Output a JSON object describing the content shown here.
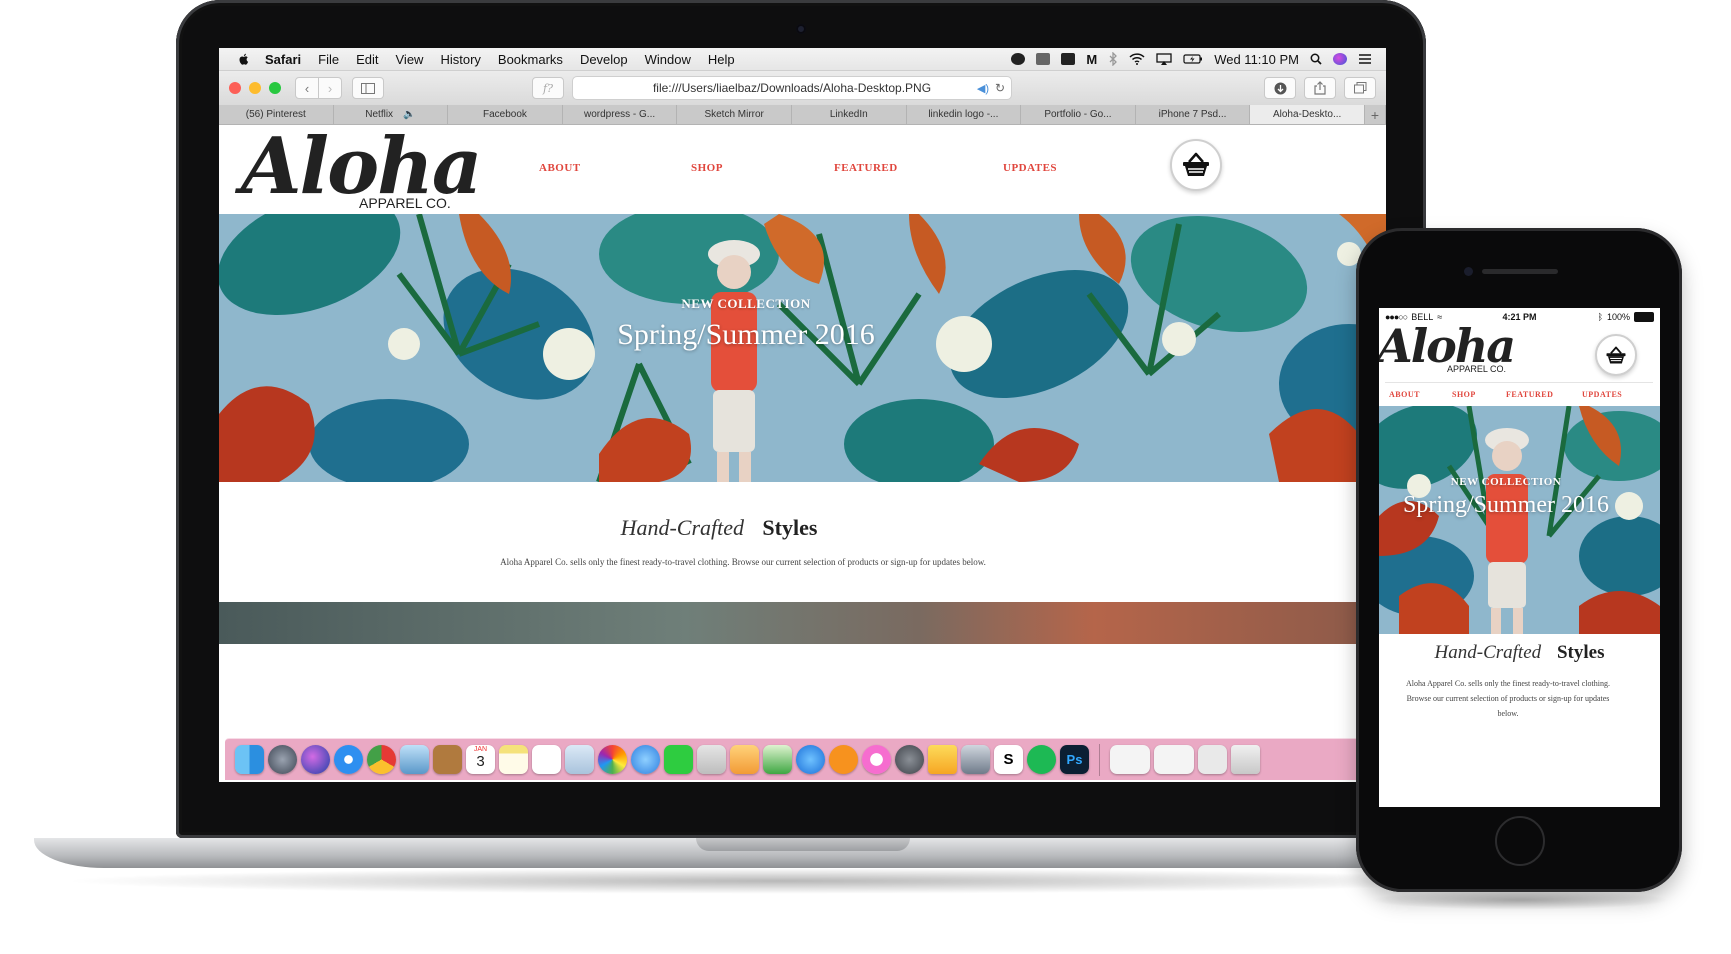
{
  "menubar": {
    "app": "Safari",
    "items": [
      "File",
      "Edit",
      "View",
      "History",
      "Bookmarks",
      "Develop",
      "Window",
      "Help"
    ],
    "clock": "Wed 11:10 PM"
  },
  "toolbar": {
    "address": "file:///Users/liaelbaz/Downloads/Aloha-Desktop.PNG",
    "reader_glyph": "f?"
  },
  "tabs": [
    {
      "label": "(56) Pinterest"
    },
    {
      "label": "Netflix"
    },
    {
      "label": "Facebook"
    },
    {
      "label": "wordpress - G..."
    },
    {
      "label": "Sketch Mirror"
    },
    {
      "label": "LinkedIn"
    },
    {
      "label": "linkedin logo -..."
    },
    {
      "label": "Portfolio - Go..."
    },
    {
      "label": "iPhone 7 Psd..."
    },
    {
      "label": "Aloha-Deskto..."
    }
  ],
  "site": {
    "logo_script": "Aloha",
    "logo_sub": "APPAREL CO.",
    "nav": [
      "ABOUT",
      "SHOP",
      "FEATURED",
      "UPDATES"
    ],
    "hero_kicker": "NEW COLLECTION",
    "hero_title": "Spring/Summer 2016",
    "heading_italic": "Hand-Crafted",
    "heading_bold": "Styles",
    "description": "Aloha Apparel Co. sells only the finest ready-to-travel clothing. Browse our current selection of products or sign-up for updates below."
  },
  "dock": {
    "calendar_month": "JAN",
    "calendar_day": "3",
    "ps_label": "Ps",
    "s_label": "S"
  },
  "phone": {
    "carrier": "BELL",
    "time": "4:21 PM",
    "battery": "100%"
  },
  "colors": {
    "accent": "#e0463d",
    "hero_sky": "#8fb7cc",
    "dock": "#e8a0be"
  }
}
